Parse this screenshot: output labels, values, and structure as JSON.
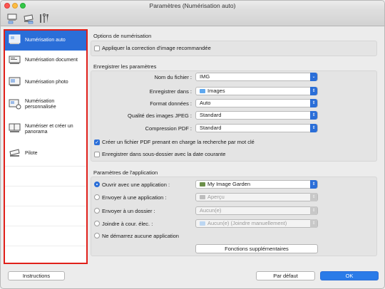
{
  "window": {
    "title": "Paramètres (Numérisation auto)"
  },
  "toolbar": {
    "buttons": [
      "scan-settings-icon",
      "scanner-settings-icon",
      "general-settings-icon"
    ]
  },
  "sidebar": {
    "items": [
      {
        "label": "Numérisation auto",
        "selected": true
      },
      {
        "label": "Numérisation document",
        "selected": false
      },
      {
        "label": "Numérisation photo",
        "selected": false
      },
      {
        "label": "Numérisation personnalisée",
        "selected": false
      },
      {
        "label": "Numériser et créer un panorama",
        "selected": false
      },
      {
        "label": "Pilote",
        "selected": false
      }
    ]
  },
  "scan_options": {
    "title": "Options de numérisation",
    "image_correction_label": "Appliquer la correction d'image recommandée",
    "image_correction_checked": false
  },
  "save_settings": {
    "title": "Enregistrer les paramètres",
    "filename_label": "Nom du fichier :",
    "filename_value": "IMG",
    "save_in_label": "Enregistrer dans :",
    "save_in_value": "Images",
    "format_label": "Format données :",
    "format_value": "Auto",
    "jpeg_quality_label": "Qualité des images JPEG :",
    "jpeg_quality_value": "Standard",
    "pdf_compression_label": "Compression PDF :",
    "pdf_compression_value": "Standard",
    "searchable_pdf_label": "Créer un fichier PDF prenant en charge la recherche par mot clé",
    "searchable_pdf_checked": true,
    "date_subfolder_label": "Enregistrer dans sous-dossier avec la date courante",
    "date_subfolder_checked": false
  },
  "app_settings": {
    "title": "Paramètres de l'application",
    "open_with_label": "Ouvrir avec une application :",
    "open_with_value": "My Image Garden",
    "send_app_label": "Envoyer à une application :",
    "send_app_value": "Aperçu",
    "send_folder_label": "Envoyer à un dossier :",
    "send_folder_value": "Aucun(e)",
    "attach_mail_label": "Joindre à cour. élec. :",
    "attach_mail_value": "Aucun(e) (Joindre manuellement)",
    "no_app_label": "Ne démarrez aucune application",
    "more_functions_label": "Fonctions supplémentaires"
  },
  "footer": {
    "instructions_label": "Instructions",
    "default_label": "Par défaut",
    "ok_label": "OK"
  },
  "colors": {
    "accent": "#2a6ed8",
    "highlight_border": "#e0201a"
  }
}
